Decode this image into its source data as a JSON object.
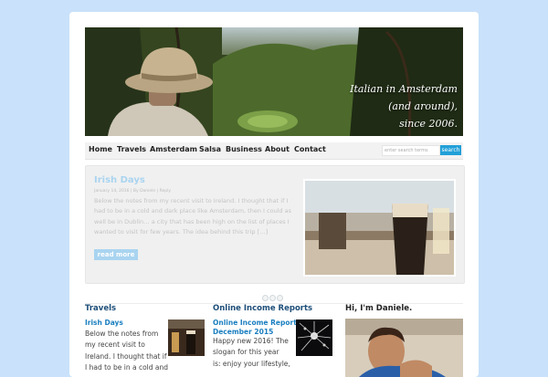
{
  "header": {
    "tagline_line1": "Italian in Amsterdam",
    "tagline_line2": "(and around),",
    "tagline_line3": "since 2006."
  },
  "nav": {
    "items": [
      "Home",
      "Travels",
      "Amsterdam",
      "Salsa",
      "Business",
      "About",
      "Contact"
    ],
    "search_placeholder": "enter search terms",
    "search_button": "search"
  },
  "featured": {
    "title": "Irish Days",
    "meta": "January 14, 2016 | By Daniele | Reply",
    "excerpt": "Below the notes from my recent visit to Ireland. I thought that if I had to be in a cold and dark place like Amsterdam, then I could as well be in Dublin… a city that has been high on the list of places I wanted to visit for few years. The idea behind this trip […]",
    "read_more": "read more"
  },
  "columns": {
    "travels": {
      "title": "Travels",
      "post_title": "Irish Days",
      "excerpt_lines": [
        "Below the notes from",
        "my recent visit to",
        "Ireland. I thought that if",
        "I had to be in a cold and"
      ]
    },
    "income": {
      "title": "Online Income Reports",
      "post_title_line1": "Online Income Report -",
      "post_title_line2": "December 2015",
      "excerpt_lines": [
        "Happy new 2016! The",
        "slogan for this year",
        "is: enjoy your lifestyle,"
      ]
    },
    "about": {
      "title": "Hi, I'm Daniele."
    }
  }
}
